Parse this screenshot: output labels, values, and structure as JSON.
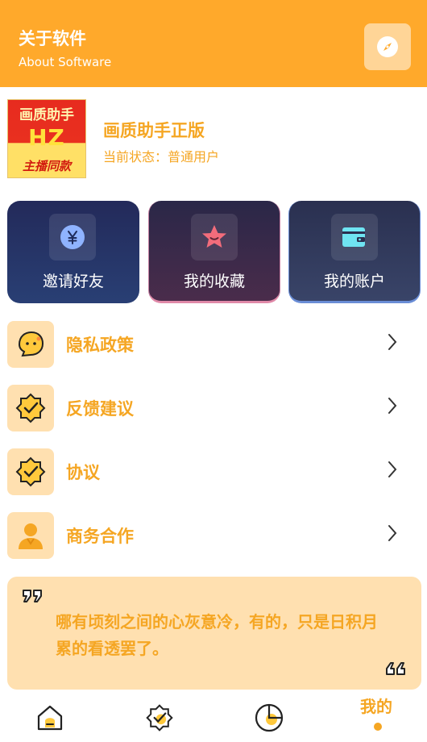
{
  "header": {
    "title": "关于软件",
    "subtitle": "About Software",
    "compass_icon": "compass-icon"
  },
  "profile": {
    "logo_lines": [
      "画质助手",
      "HZ",
      "主播同款"
    ],
    "name": "画质助手正版",
    "status": "当前状态：普通用户"
  },
  "cards": [
    {
      "label": "邀请好友",
      "icon": "yen-coin-icon"
    },
    {
      "label": "我的收藏",
      "icon": "star-icon"
    },
    {
      "label": "我的账户",
      "icon": "wallet-icon"
    }
  ],
  "menu": [
    {
      "label": "隐私政策",
      "icon": "chat-face-icon"
    },
    {
      "label": "反馈建议",
      "icon": "badge-check-icon"
    },
    {
      "label": "协议",
      "icon": "badge-check-icon"
    },
    {
      "label": "商务合作",
      "icon": "person-icon"
    }
  ],
  "quote": {
    "text": "哪有顷刻之间的心灰意冷，有的，只是日积月累的看透罢了。"
  },
  "tabbar": {
    "active_label": "我的",
    "tabs": [
      "home-icon",
      "badge-check-icon",
      "pie-chart-icon",
      "我的"
    ]
  },
  "colors": {
    "accent": "#FFA92B",
    "text_accent": "#F5A623",
    "soft_bg": "#FFE0B0"
  }
}
